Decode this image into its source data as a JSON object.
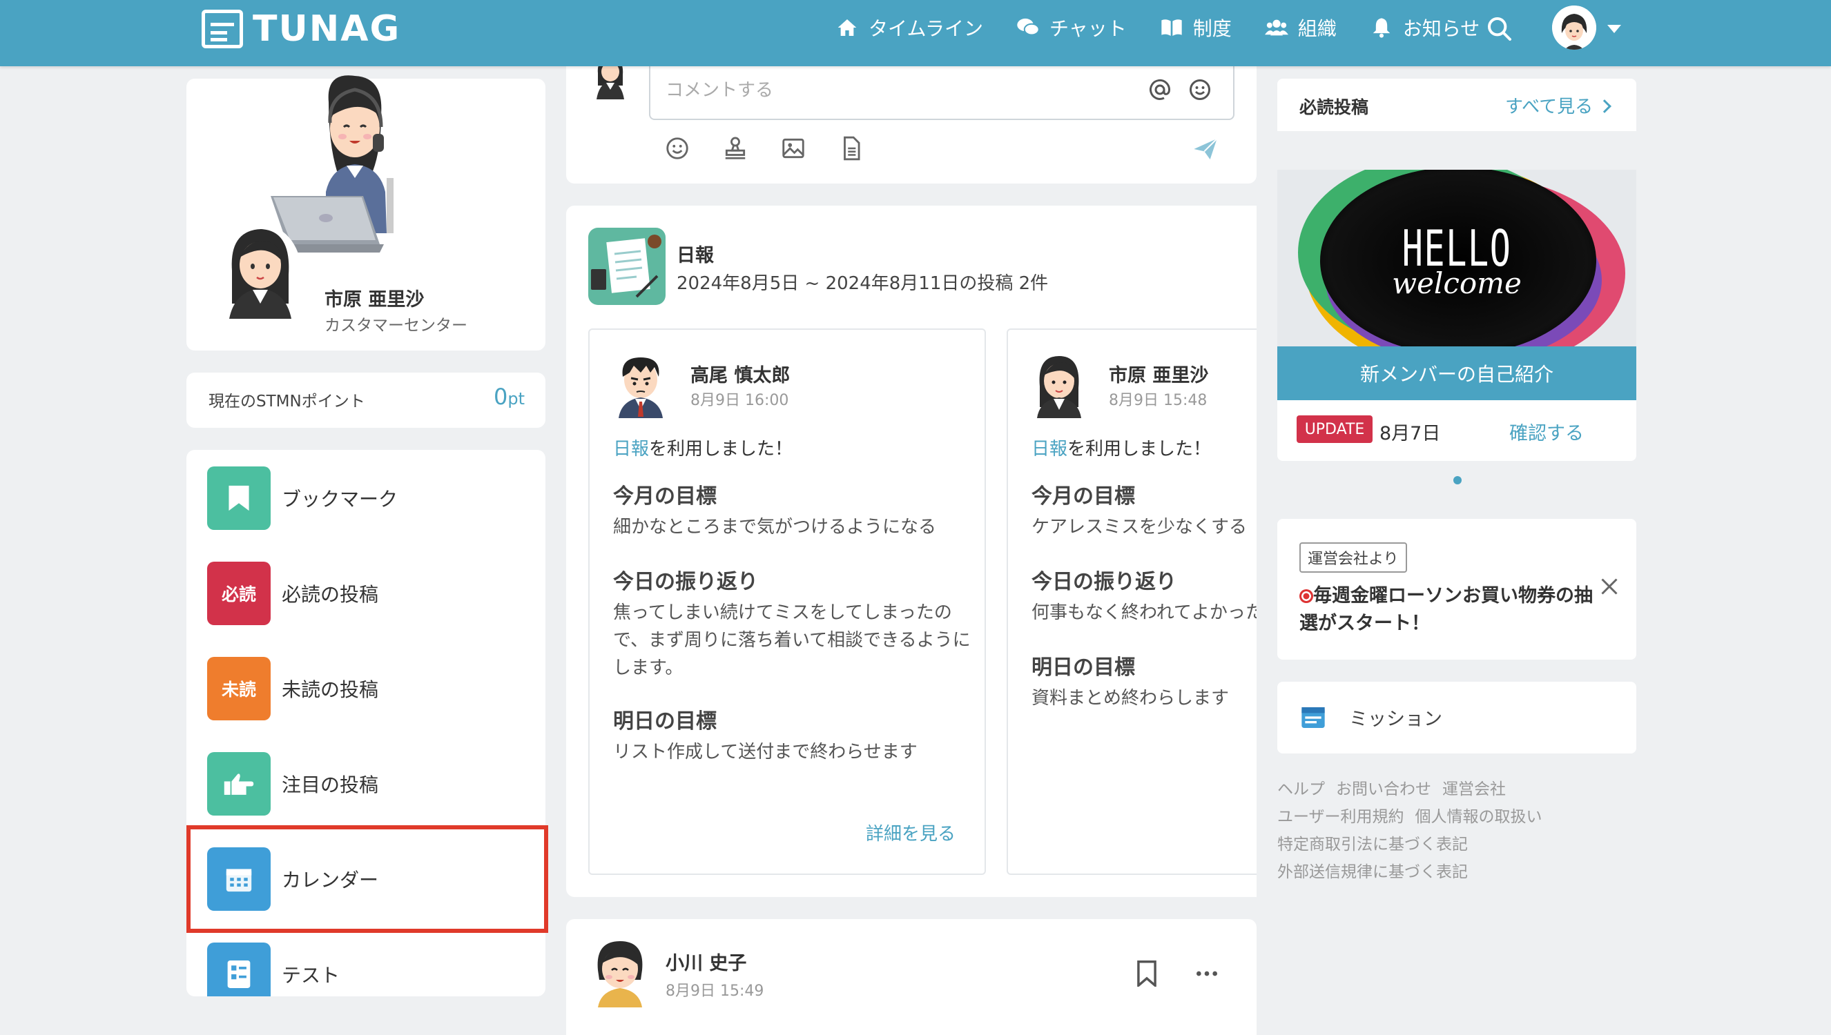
{
  "header": {
    "logo_text": "TUNAG",
    "nav": [
      {
        "label": "タイムライン",
        "icon": "home-icon"
      },
      {
        "label": "チャット",
        "icon": "chat-icon"
      },
      {
        "label": "制度",
        "icon": "book-icon"
      },
      {
        "label": "組織",
        "icon": "people-icon"
      },
      {
        "label": "お知らせ",
        "icon": "bell-icon"
      }
    ]
  },
  "profile": {
    "name": "市原 亜里沙",
    "department": "カスタマーセンター"
  },
  "points": {
    "label": "現在のSTMNポイント",
    "value": "0",
    "unit": "pt"
  },
  "menu": {
    "items": [
      {
        "label": "ブックマーク",
        "icon": "bookmark-icon",
        "badge": "",
        "color": "#4cbfa0"
      },
      {
        "label": "必読の投稿",
        "icon": "must-read-icon",
        "badge": "必読",
        "color": "#d2324a"
      },
      {
        "label": "未読の投稿",
        "icon": "unread-icon",
        "badge": "未読",
        "color": "#ef7d2d"
      },
      {
        "label": "注目の投稿",
        "icon": "pointing-hand-icon",
        "badge": "",
        "color": "#4cbfa0"
      },
      {
        "label": "カレンダー",
        "icon": "calendar-icon",
        "badge": "",
        "color": "#3f9ed8"
      },
      {
        "label": "テスト",
        "icon": "test-icon",
        "badge": "",
        "color": "#3f9ed8"
      }
    ]
  },
  "comment": {
    "placeholder": "コメントする"
  },
  "daily_report": {
    "title": "日報",
    "subtitle": "2024年8月5日 ~ 2024年8月11日の投稿 2件",
    "posts": [
      {
        "author": "高尾 慎太郎",
        "date": "8月9日 16:00",
        "used_link": "日報",
        "used_text": "を利用しました！",
        "sections": [
          {
            "heading": "今月の目標",
            "body": "細かなところまで気がつけるようになる"
          },
          {
            "heading": "今日の振り返り",
            "body": "焦ってしまい続けてミスをしてしまったので、まず周りに落ち着いて相談できるようにします。"
          },
          {
            "heading": "明日の目標",
            "body": "リスト作成して送付まで終わらせます"
          }
        ],
        "detail_link": "詳細を見る"
      },
      {
        "author": "市原 亜里沙",
        "date": "8月9日 15:48",
        "used_link": "日報",
        "used_text": "を利用しました！",
        "sections": [
          {
            "heading": "今月の目標",
            "body": "ケアレスミスを少なくする"
          },
          {
            "heading": "今日の振り返り",
            "body": "何事もなく終われてよかった"
          },
          {
            "heading": "明日の目標",
            "body": "資料まとめ終わらします"
          }
        ]
      }
    ]
  },
  "next_post": {
    "author": "小川 史子",
    "date": "8月9日 15:49"
  },
  "must_read": {
    "title": "必読投稿",
    "see_all": "すべて見る",
    "banner_text_top": "HELLO",
    "banner_text_bottom": "welcome",
    "banner_caption": "新メンバーの自己紹介",
    "badge": "UPDATE",
    "date": "8月7日",
    "confirm": "確認する"
  },
  "notice": {
    "badge": "運営会社より",
    "text": "毎週金曜ローソンお買い物券の抽選がスタート！"
  },
  "mission": {
    "label": "ミッション"
  },
  "footer": {
    "rows": [
      [
        "ヘルプ",
        "お問い合わせ",
        "運営会社"
      ],
      [
        "ユーザー利用規約",
        "個人情報の取扱い"
      ],
      [
        "特定商取引法に基づく表記"
      ],
      [
        "外部送信規律に基づく表記"
      ]
    ]
  },
  "colors": {
    "brand": "#4aa3c2",
    "highlight": "#e03a2a",
    "update_badge": "#d2324a"
  }
}
